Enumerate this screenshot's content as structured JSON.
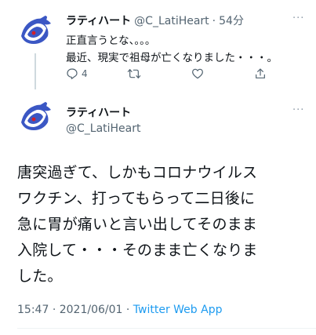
{
  "tweet1": {
    "display_name": "ラティハート",
    "handle": "@C_LatiHeart",
    "separator": "·",
    "time": "54分",
    "lines": [
      "正直言うとな、。。。",
      "最近、現実で祖母が亡くなりました・・・。"
    ],
    "actions": {
      "reply_count": "4",
      "reply_icon": "reply-icon",
      "retweet_icon": "retweet-icon",
      "like_icon": "like-icon",
      "share_icon": "share-icon"
    },
    "more": "···"
  },
  "tweet2": {
    "display_name": "ラティハート",
    "handle": "@C_LatiHeart",
    "more": "···",
    "text_lines": [
      "唐突過ぎて、しかもコロナウイルス",
      "ワクチン、打ってもらって二日後に",
      "急に胃が痛いと言い出してそのまま",
      "入院して・・・そのまま亡くなりま",
      "した。"
    ],
    "meta": {
      "time": "15:47",
      "date": "2021/06/01",
      "separator": "·",
      "source": "Twitter Web App"
    }
  },
  "colors": {
    "text": "#0f1419",
    "muted": "#536471",
    "link": "#1d9bf0",
    "thread_line": "#cfd9de"
  }
}
